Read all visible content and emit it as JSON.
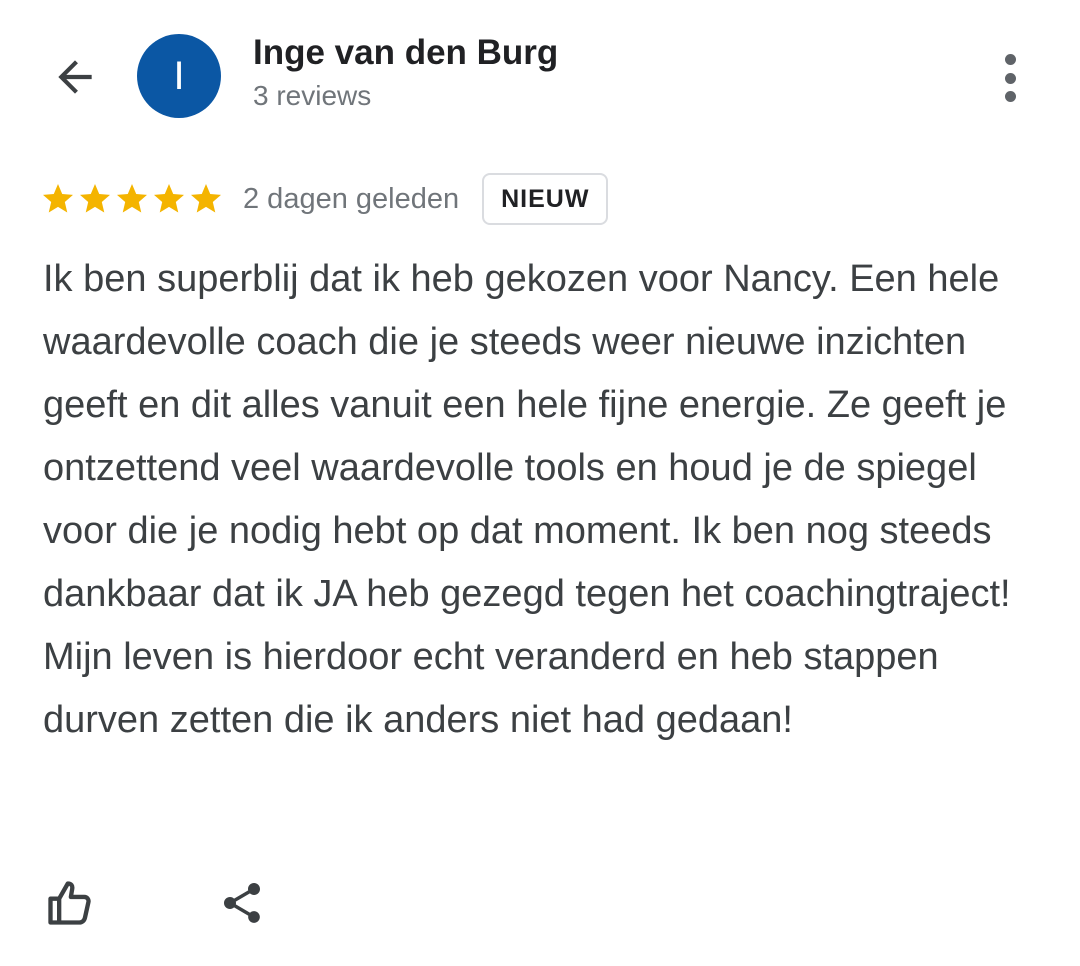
{
  "colors": {
    "avatar_bg": "#0b57a4",
    "star": "#f4b400",
    "icon": "#3c4043"
  },
  "header": {
    "back_icon": "arrow-left-icon",
    "avatar_initial": "I",
    "reviewer_name": "Inge van den Burg",
    "review_count": "3 reviews",
    "more_icon": "more-vertical-icon"
  },
  "review": {
    "rating": 5,
    "max_rating": 5,
    "time_ago": "2 dagen geleden",
    "badge": "NIEUW",
    "text": "Ik ben superblij dat ik heb gekozen voor Nancy. Een hele waardevolle coach die je steeds weer nieuwe inzichten geeft en dit alles vanuit een hele fijne energie. Ze geeft je ontzettend veel waardevolle tools en houd je de spiegel voor die je nodig hebt op dat moment. Ik ben nog steeds dankbaar dat ik JA heb gezegd tegen het coachingtraject! Mijn leven is hierdoor echt veranderd en heb stappen durven zetten die ik anders niet had gedaan!"
  },
  "actions": {
    "like_icon": "thumbs-up-icon",
    "share_icon": "share-icon"
  }
}
